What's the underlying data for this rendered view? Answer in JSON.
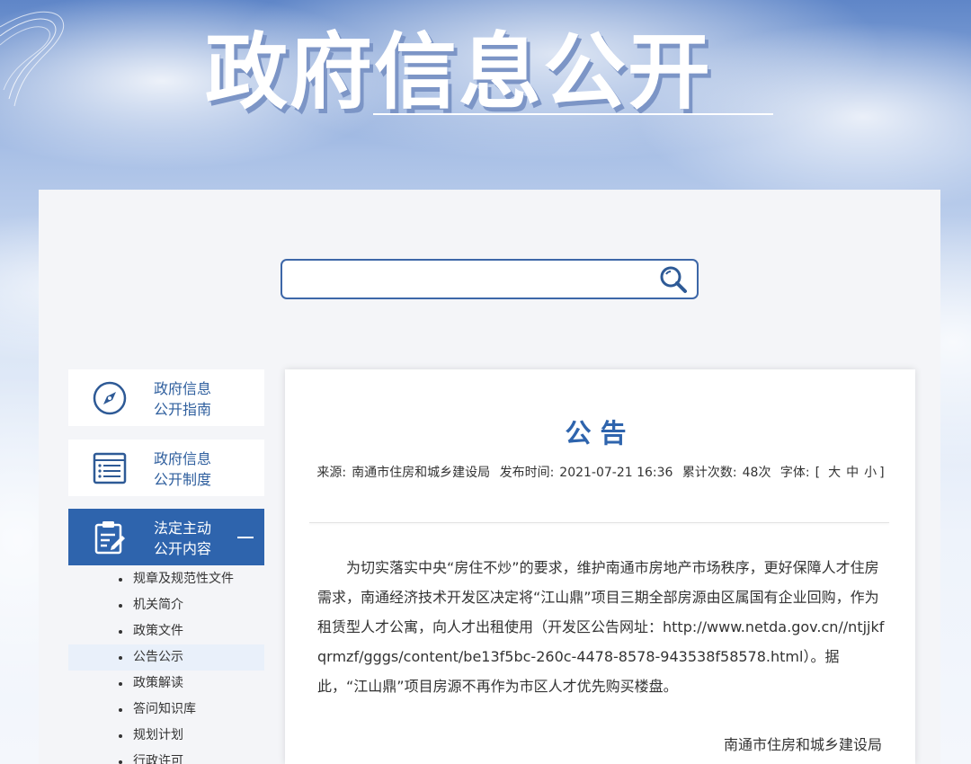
{
  "header": {
    "title": "政府信息公开"
  },
  "search": {
    "value": "",
    "placeholder": ""
  },
  "sidebar": {
    "items": [
      {
        "line1": "政府信息",
        "line2": "公开指南",
        "icon": "compass-icon"
      },
      {
        "line1": "政府信息",
        "line2": "公开制度",
        "icon": "list-document-icon"
      },
      {
        "line1": "法定主动",
        "line2": "公开内容",
        "icon": "clipboard-edit-icon",
        "active": true
      }
    ],
    "subitems": [
      {
        "label": "规章及规范性文件"
      },
      {
        "label": "机关简介"
      },
      {
        "label": "政策文件"
      },
      {
        "label": "公告公示",
        "selected": true
      },
      {
        "label": "政策解读"
      },
      {
        "label": "答问知识库"
      },
      {
        "label": "规划计划"
      },
      {
        "label": "行政许可"
      }
    ]
  },
  "article": {
    "title": "公告",
    "source_label": "来源:",
    "source": "南通市住房和城乡建设局",
    "time_label": "发布时间:",
    "time": "2021-07-21 16:36",
    "views_label": "累计次数:",
    "views": "48次",
    "font_label": "字体:",
    "font_open": "[",
    "font_large": "大",
    "font_medium": "中",
    "font_small": "小",
    "font_close": "]",
    "body": "为切实落实中央“房住不炒”的要求，维护南通市房地产市场秩序，更好保障人才住房需求，南通经济技术开发区决定将“江山鼎”项目三期全部房源由区属国有企业回购，作为租赁型人才公寓，向人才出租使用（开发区公告网址：http://www.netda.gov.cn//ntjjkfqrmzf/gggs/content/be13f5bc-260c-4478-8578-943538f58578.html）。据此，“江山鼎”项目房源不再作为市区人才优先购买楼盘。",
    "signature": "南通市住房和城乡建设局"
  },
  "colors": {
    "accent": "#2e64ad",
    "title_shadow": "#7c95c6",
    "panel": "#f4f5f8"
  }
}
